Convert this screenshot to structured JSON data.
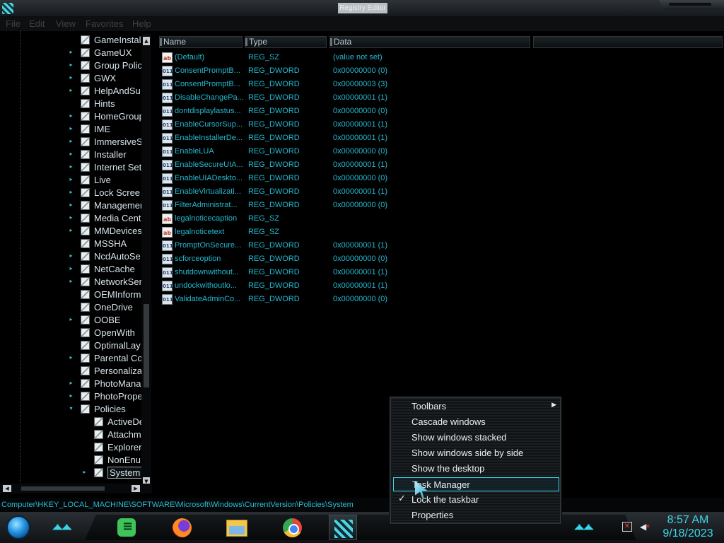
{
  "window": {
    "title": "Registry Editor"
  },
  "menu": [
    "File",
    "Edit",
    "View",
    "Favorites",
    "Help"
  ],
  "tree": {
    "items": [
      {
        "label": "GameInstal",
        "expander": ""
      },
      {
        "label": "GameUX",
        "expander": "▸"
      },
      {
        "label": "Group Polic",
        "expander": "▸"
      },
      {
        "label": "GWX",
        "expander": "▸"
      },
      {
        "label": "HelpAndSu",
        "expander": "▸"
      },
      {
        "label": "Hints",
        "expander": ""
      },
      {
        "label": "HomeGroup",
        "expander": "▸"
      },
      {
        "label": "IME",
        "expander": "▸"
      },
      {
        "label": "ImmersiveS",
        "expander": "▸"
      },
      {
        "label": "Installer",
        "expander": "▸"
      },
      {
        "label": "Internet Set",
        "expander": "▸"
      },
      {
        "label": "Live",
        "expander": "▸"
      },
      {
        "label": "Lock Scree",
        "expander": "▸"
      },
      {
        "label": "Managemer",
        "expander": "▸"
      },
      {
        "label": "Media Cent",
        "expander": "▸"
      },
      {
        "label": "MMDevices",
        "expander": "▸"
      },
      {
        "label": "MSSHA",
        "expander": ""
      },
      {
        "label": "NcdAutoSe",
        "expander": "▸"
      },
      {
        "label": "NetCache",
        "expander": "▸"
      },
      {
        "label": "NetworkSer",
        "expander": "▸"
      },
      {
        "label": "OEMInform",
        "expander": ""
      },
      {
        "label": "OneDrive",
        "expander": ""
      },
      {
        "label": "OOBE",
        "expander": "▸"
      },
      {
        "label": "OpenWith",
        "expander": ""
      },
      {
        "label": "OptimalLay",
        "expander": ""
      },
      {
        "label": "Parental Co",
        "expander": "▸"
      },
      {
        "label": "Personaliza",
        "expander": ""
      },
      {
        "label": "PhotoMana",
        "expander": "▸"
      },
      {
        "label": "PhotoPrope",
        "expander": "▸"
      },
      {
        "label": "Policies",
        "expander": "▾"
      },
      {
        "label": "ActiveDe",
        "expander": "",
        "child": true
      },
      {
        "label": "Attachm",
        "expander": "",
        "child": true
      },
      {
        "label": "Explorer",
        "expander": "",
        "child": true
      },
      {
        "label": "NonEnu",
        "expander": "",
        "child": true
      },
      {
        "label": "System",
        "expander": "▸",
        "child": true,
        "selected": true
      }
    ]
  },
  "columns": [
    "Name",
    "Type",
    "Data"
  ],
  "values": [
    {
      "icon": "ab",
      "kind": "sz",
      "name": "(Default)",
      "type": "REG_SZ",
      "data": "(value not set)"
    },
    {
      "icon": "011",
      "kind": "dword",
      "name": "ConsentPromptB...",
      "type": "REG_DWORD",
      "data": "0x00000000 (0)"
    },
    {
      "icon": "011",
      "kind": "dword",
      "name": "ConsentPromptB...",
      "type": "REG_DWORD",
      "data": "0x00000003 (3)"
    },
    {
      "icon": "011",
      "kind": "dword",
      "name": "DisableChangePa...",
      "type": "REG_DWORD",
      "data": "0x00000001 (1)"
    },
    {
      "icon": "011",
      "kind": "dword",
      "name": "dontdisplaylastus...",
      "type": "REG_DWORD",
      "data": "0x00000000 (0)"
    },
    {
      "icon": "011",
      "kind": "dword",
      "name": "EnableCursorSup...",
      "type": "REG_DWORD",
      "data": "0x00000001 (1)"
    },
    {
      "icon": "011",
      "kind": "dword",
      "name": "EnableInstallerDe...",
      "type": "REG_DWORD",
      "data": "0x00000001 (1)"
    },
    {
      "icon": "011",
      "kind": "dword",
      "name": "EnableLUA",
      "type": "REG_DWORD",
      "data": "0x00000000 (0)"
    },
    {
      "icon": "011",
      "kind": "dword",
      "name": "EnableSecureUIA...",
      "type": "REG_DWORD",
      "data": "0x00000001 (1)"
    },
    {
      "icon": "011",
      "kind": "dword",
      "name": "EnableUIADeskto...",
      "type": "REG_DWORD",
      "data": "0x00000000 (0)"
    },
    {
      "icon": "011",
      "kind": "dword",
      "name": "EnableVirtualizati...",
      "type": "REG_DWORD",
      "data": "0x00000001 (1)"
    },
    {
      "icon": "011",
      "kind": "dword",
      "name": "FilterAdministrat...",
      "type": "REG_DWORD",
      "data": "0x00000000 (0)"
    },
    {
      "icon": "ab",
      "kind": "sz",
      "name": "legalnoticecaption",
      "type": "REG_SZ",
      "data": ""
    },
    {
      "icon": "ab",
      "kind": "sz",
      "name": "legalnoticetext",
      "type": "REG_SZ",
      "data": ""
    },
    {
      "icon": "011",
      "kind": "dword",
      "name": "PromptOnSecure...",
      "type": "REG_DWORD",
      "data": "0x00000001 (1)"
    },
    {
      "icon": "011",
      "kind": "dword",
      "name": "scforceoption",
      "type": "REG_DWORD",
      "data": "0x00000000 (0)"
    },
    {
      "icon": "011",
      "kind": "dword",
      "name": "shutdownwithout...",
      "type": "REG_DWORD",
      "data": "0x00000001 (1)"
    },
    {
      "icon": "011",
      "kind": "dword",
      "name": "undockwithoutlo...",
      "type": "REG_DWORD",
      "data": "0x00000001 (1)"
    },
    {
      "icon": "011",
      "kind": "dword",
      "name": "ValidateAdminCo...",
      "type": "REG_DWORD",
      "data": "0x00000000 (0)"
    }
  ],
  "status": {
    "path": "Computer\\HKEY_LOCAL_MACHINE\\SOFTWARE\\Microsoft\\Windows\\CurrentVersion\\Policies\\System"
  },
  "context_menu": {
    "items": [
      {
        "label": "Toolbars",
        "submenu": true
      },
      {
        "label": "Cascade windows"
      },
      {
        "label": "Show windows stacked"
      },
      {
        "label": "Show windows side by side"
      },
      {
        "label": "Show the desktop"
      },
      {
        "label": "Task Manager",
        "highlighted": true
      },
      {
        "label": "Lock the taskbar",
        "checked": true
      },
      {
        "label": "Properties"
      }
    ]
  },
  "taskbar": {
    "apps": [
      "notes-app-icon",
      "firefox-icon",
      "file-explorer-icon",
      "chrome-icon",
      "registry-editor-icon"
    ],
    "active_app": "registry-editor-icon"
  },
  "clock": {
    "time": "8:57 AM",
    "date": "9/18/2023"
  },
  "colors": {
    "accent": "#3fd6ea",
    "value_text": "#25b8cf",
    "background": "#000000"
  }
}
